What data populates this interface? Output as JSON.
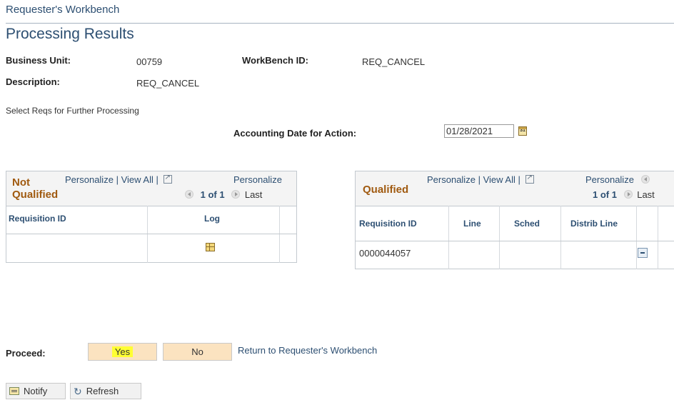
{
  "breadcrumb": "Requester's Workbench",
  "page_title": "Processing Results",
  "fields": {
    "business_unit_label": "Business Unit:",
    "business_unit_value": "00759",
    "workbench_id_label": "WorkBench ID:",
    "workbench_id_value": "REQ_CANCEL",
    "description_label": "Description:",
    "description_value": "REQ_CANCEL"
  },
  "instruction": "Select Reqs for Further Processing",
  "accounting_date": {
    "label": "Accounting Date for Action:",
    "value": "01/28/2021"
  },
  "not_qualified_grid": {
    "title_line1": "Not",
    "title_line2": "Qualified",
    "personalize": "Personalize",
    "view_all": "View All",
    "personalize2": "Personalize",
    "pager": "1 of 1",
    "last": "Last",
    "columns": [
      "Requisition ID",
      "Log"
    ],
    "rows": [
      {
        "requisition_id": "",
        "log_icon": "log-icon"
      }
    ]
  },
  "qualified_grid": {
    "title": "Qualified",
    "personalize": "Personalize",
    "view_all": "View All",
    "personalize2": "Personalize",
    "pager": "1 of 1",
    "last": "Last",
    "columns": [
      "Requisition ID",
      "Line",
      "Sched",
      "Distrib Line"
    ],
    "rows": [
      {
        "requisition_id": "0000044057",
        "line": "",
        "sched": "",
        "distrib_line": "",
        "action_icon": "delete-row-icon"
      }
    ]
  },
  "proceed": {
    "label": "Proceed:",
    "yes": "Yes",
    "no": "No",
    "return_link": "Return to Requester's Workbench"
  },
  "toolbar": {
    "notify": "Notify",
    "refresh": "Refresh"
  },
  "colors": {
    "link": "#2d4f72",
    "grid_title": "#a05a10",
    "button_bg": "#fbe3c0",
    "highlight": "#ffff33"
  }
}
